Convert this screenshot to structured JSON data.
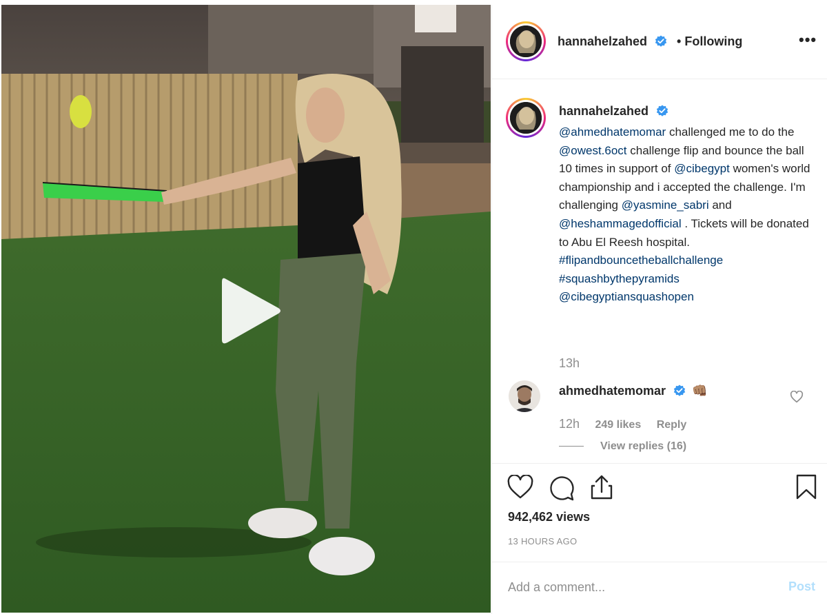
{
  "post": {
    "author": "hannahelzahed",
    "verified": true,
    "separator": "•",
    "follow_status": "Following",
    "more_label": "•••",
    "video": {
      "play_icon": "play-icon"
    }
  },
  "caption": {
    "username": "hannahelzahed",
    "segments": [
      {
        "text": "@ahmedhatemomar",
        "type": "mention"
      },
      {
        "text": " challenged me to do the ",
        "type": "text"
      },
      {
        "text": "@owest.6oct",
        "type": "mention"
      },
      {
        "text": " challenge flip and bounce the ball 10 times in support of ",
        "type": "text"
      },
      {
        "text": "@cibegypt",
        "type": "mention"
      },
      {
        "text": " women's world championship and i accepted the challenge. I'm challenging ",
        "type": "text"
      },
      {
        "text": "@yasmine_sabri",
        "type": "mention"
      },
      {
        "text": " and ",
        "type": "text"
      },
      {
        "text": "@heshammagedofficial",
        "type": "mention"
      },
      {
        "text": " . Tickets will be donated to Abu El Reesh hospital. ",
        "type": "text"
      },
      {
        "text": "#flipandbouncetheballchallenge",
        "type": "hashtag"
      },
      {
        "text": " ",
        "type": "text"
      },
      {
        "text": "#squashbythepyramids",
        "type": "hashtag"
      },
      {
        "text": " ",
        "type": "text"
      },
      {
        "text": "@cibegyptiansquashopen",
        "type": "mention"
      }
    ],
    "time": "13h"
  },
  "comments": [
    {
      "username": "ahmedhatemomar",
      "verified": true,
      "emoji": "👊🏽",
      "time": "12h",
      "likes": "249 likes",
      "reply_label": "Reply",
      "view_replies": "View replies (16)"
    }
  ],
  "actions": {
    "icons": [
      "heart-icon",
      "comment-icon",
      "share-icon",
      "bookmark-icon"
    ],
    "views": "942,462 views",
    "time_ago": "13 HOURS AGO"
  },
  "comment_box": {
    "placeholder": "Add a comment...",
    "post_label": "Post"
  },
  "colors": {
    "link": "#00376b",
    "verified": "#3897f0",
    "muted": "#8e8e8e",
    "post_disabled": "#b2dffc"
  }
}
